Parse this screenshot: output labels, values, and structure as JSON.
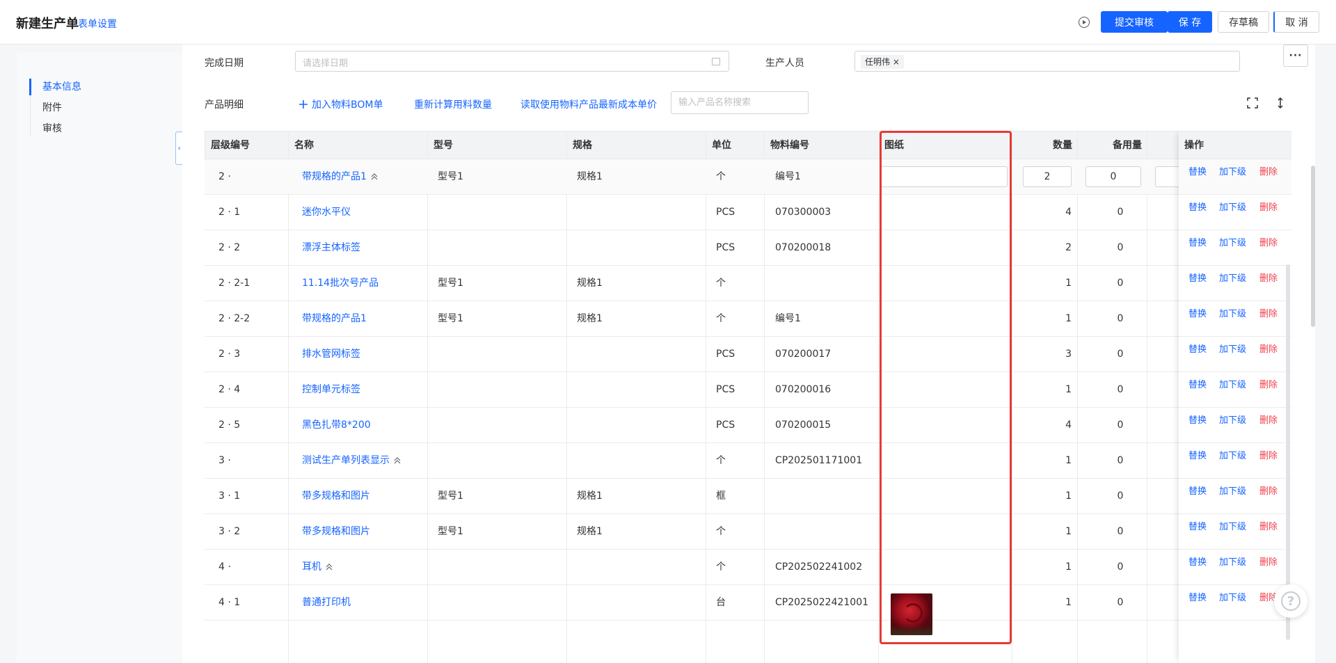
{
  "header": {
    "title": "新建生产单",
    "form_settings": "表单设置",
    "submit_label": "提交审核",
    "save_label": "保 存",
    "draft_label": "存草稿",
    "cancel_label": "取 消"
  },
  "sidebar": {
    "items": [
      {
        "label": "基本信息",
        "active": true
      },
      {
        "label": "附件",
        "active": false
      },
      {
        "label": "审核",
        "active": false
      }
    ]
  },
  "form": {
    "completion_date_label": "完成日期",
    "completion_date_placeholder": "请选择日期",
    "producer_label": "生产人员",
    "producer_tag": "任明伟"
  },
  "tools": {
    "section_label": "产品明细",
    "add_bom": "加入物料BOM单",
    "recalc": "重新计算用料数量",
    "read_cost": "读取使用物料产品最新成本单价",
    "search_placeholder": "输入产品名称搜索"
  },
  "table": {
    "columns": [
      "层级编号",
      "名称",
      "型号",
      "规格",
      "单位",
      "物料编号",
      "图纸",
      "数量",
      "备用量",
      "操作"
    ],
    "rows": [
      {
        "level": "2 ·",
        "name": "带规格的产品1",
        "collapsible": true,
        "model": "型号1",
        "spec": "规格1",
        "unit": "个",
        "code": "编号1",
        "qty": "2",
        "spare": "0",
        "editable": true,
        "image": false
      },
      {
        "level": "2 · 1",
        "name": "迷你水平仪",
        "collapsible": false,
        "model": "",
        "spec": "",
        "unit": "PCS",
        "code": "070300003",
        "qty": "4",
        "spare": "0",
        "editable": false,
        "image": false
      },
      {
        "level": "2 · 2",
        "name": "漂浮主体标签",
        "collapsible": false,
        "model": "",
        "spec": "",
        "unit": "PCS",
        "code": "070200018",
        "qty": "2",
        "spare": "0",
        "editable": false,
        "image": false
      },
      {
        "level": "2 · 2-1",
        "name": "11.14批次号产品",
        "collapsible": false,
        "model": "型号1",
        "spec": "规格1",
        "unit": "个",
        "code": "",
        "qty": "1",
        "spare": "0",
        "editable": false,
        "image": false
      },
      {
        "level": "2 · 2-2",
        "name": "带规格的产品1",
        "collapsible": false,
        "model": "型号1",
        "spec": "规格1",
        "unit": "个",
        "code": "编号1",
        "qty": "1",
        "spare": "0",
        "editable": false,
        "image": false
      },
      {
        "level": "2 · 3",
        "name": "排水管网标签",
        "collapsible": false,
        "model": "",
        "spec": "",
        "unit": "PCS",
        "code": "070200017",
        "qty": "3",
        "spare": "0",
        "editable": false,
        "image": false
      },
      {
        "level": "2 · 4",
        "name": "控制单元标签",
        "collapsible": false,
        "model": "",
        "spec": "",
        "unit": "PCS",
        "code": "070200016",
        "qty": "1",
        "spare": "0",
        "editable": false,
        "image": false
      },
      {
        "level": "2 · 5",
        "name": "黑色扎带8*200",
        "collapsible": false,
        "model": "",
        "spec": "",
        "unit": "PCS",
        "code": "070200015",
        "qty": "4",
        "spare": "0",
        "editable": false,
        "image": false
      },
      {
        "level": "3 ·",
        "name": "测试生产单列表显示",
        "collapsible": true,
        "model": "",
        "spec": "",
        "unit": "个",
        "code": "CP202501171001",
        "qty": "1",
        "spare": "0",
        "editable": false,
        "image": false
      },
      {
        "level": "3 · 1",
        "name": "带多规格和图片",
        "collapsible": false,
        "model": "型号1",
        "spec": "规格1",
        "unit": "框",
        "code": "",
        "qty": "1",
        "spare": "0",
        "editable": false,
        "image": false
      },
      {
        "level": "3 · 2",
        "name": "带多规格和图片",
        "collapsible": false,
        "model": "型号1",
        "spec": "规格1",
        "unit": "个",
        "code": "",
        "qty": "1",
        "spare": "0",
        "editable": false,
        "image": false
      },
      {
        "level": "4 ·",
        "name": "耳机",
        "collapsible": true,
        "model": "",
        "spec": "",
        "unit": "个",
        "code": "CP202502241002",
        "qty": "1",
        "spare": "0",
        "editable": false,
        "image": false
      },
      {
        "level": "4 · 1",
        "name": "普通打印机",
        "collapsible": false,
        "model": "",
        "spec": "",
        "unit": "台",
        "code": "CP2025022421001",
        "qty": "1",
        "spare": "0",
        "editable": false,
        "image": true
      }
    ],
    "actions": {
      "replace": "替换",
      "add_child": "加下级",
      "delete": "删除"
    }
  },
  "colors": {
    "accent": "#1664ff",
    "danger": "#f0404a",
    "highlight": "#e53935"
  },
  "icons": [
    "play-circle-icon",
    "calendar-icon",
    "plus-icon",
    "fullscreen-icon",
    "column-height-icon",
    "chevron-up-icon",
    "help-icon"
  ]
}
